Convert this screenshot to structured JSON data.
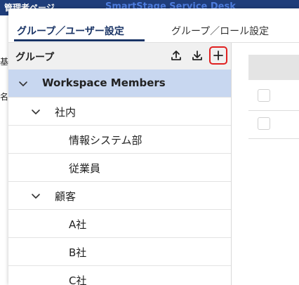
{
  "background": {
    "title": "管理者ページ",
    "right_title": "SmartStage Service Desk",
    "side_label_1": "基",
    "side_label_2": "名"
  },
  "tabs": [
    {
      "label": "グループ／ユーザー設定",
      "active": true
    },
    {
      "label": "グループ／ロール設定",
      "active": false
    }
  ],
  "group_pane": {
    "title": "グループ",
    "icons": [
      "upload-icon",
      "download-icon",
      "add-icon"
    ],
    "tree": [
      {
        "label": "Workspace Members",
        "level": 0,
        "expandable": true,
        "selected": true
      },
      {
        "label": "社内",
        "level": 1,
        "expandable": true,
        "selected": false
      },
      {
        "label": "情報システム部",
        "level": 2,
        "expandable": false,
        "selected": false
      },
      {
        "label": "従業員",
        "level": 2,
        "expandable": false,
        "selected": false
      },
      {
        "label": "顧客",
        "level": 1,
        "expandable": true,
        "selected": false
      },
      {
        "label": "A社",
        "level": 2,
        "expandable": false,
        "selected": false
      },
      {
        "label": "B社",
        "level": 2,
        "expandable": false,
        "selected": false
      },
      {
        "label": "C社",
        "level": 2,
        "expandable": false,
        "selected": false
      }
    ]
  },
  "colors": {
    "accent": "#1a3466",
    "selected_row": "#c8d7f0",
    "highlight_border": "#e02020"
  }
}
